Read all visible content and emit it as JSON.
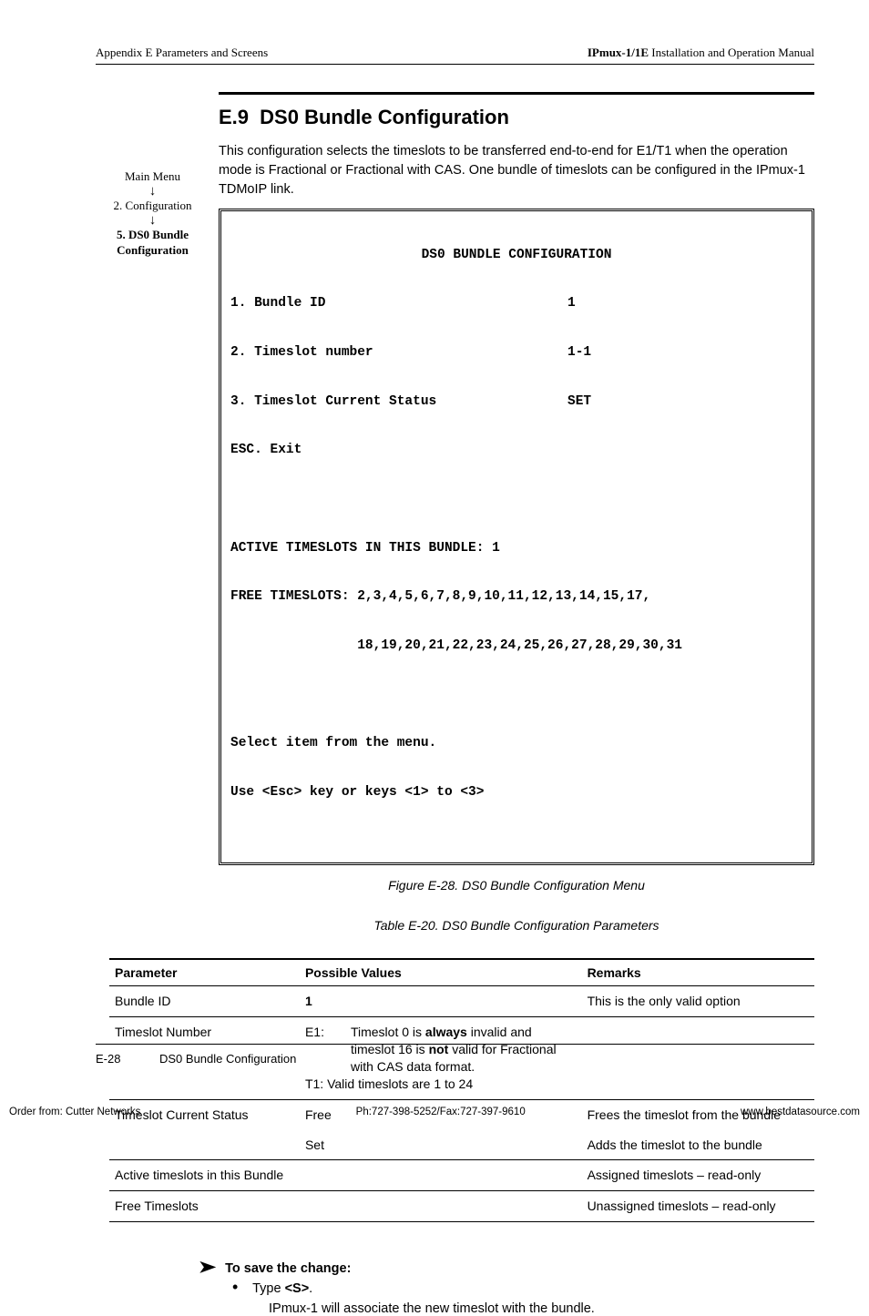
{
  "header": {
    "left": "Appendix E  Parameters and Screens",
    "right_bold": "IPmux-1/1E",
    "right_rest": " Installation and Operation Manual"
  },
  "sidebar": {
    "l1": "Main Menu",
    "arrow": "↓",
    "l2": "2. Configuration",
    "l3a": "5. DS0 Bundle",
    "l3b": "Configuration"
  },
  "section": {
    "number": "E.9",
    "title": "DS0 Bundle Configuration",
    "intro": "This configuration selects the timeslots to be transferred end-to-end for E1/T1 when the operation mode is Fractional or Fractional with CAS. One bundle of timeslots can be configured in the IPmux-1 TDMoIP link."
  },
  "terminal": {
    "title": "DS0 BUNDLE CONFIGURATION",
    "rows": [
      {
        "k": "1. Bundle ID",
        "v": "1"
      },
      {
        "k": "2. Timeslot number",
        "v": "1-1"
      },
      {
        "k": "3. Timeslot Current Status",
        "v": "SET"
      }
    ],
    "esc": "ESC. Exit",
    "active": "ACTIVE TIMESLOTS IN THIS BUNDLE: 1",
    "free1": "FREE TIMESLOTS: 2,3,4,5,6,7,8,9,10,11,12,13,14,15,17,",
    "free2": "                18,19,20,21,22,23,24,25,26,27,28,29,30,31",
    "sel": "Select item from the menu.",
    "use": "Use <Esc> key or keys <1> to <3>"
  },
  "figure_caption": "Figure E-28.  DS0 Bundle Configuration Menu",
  "table_caption": "Table E-20.  DS0 Bundle Configuration Parameters",
  "table": {
    "head": [
      "Parameter",
      "Possible Values",
      "Remarks"
    ],
    "r1": {
      "p": "Bundle ID",
      "v": "1",
      "r": "This is the only valid option"
    },
    "r2": {
      "p": "Timeslot Number",
      "e1_label": "E1:",
      "e1_a": "Timeslot 0 is ",
      "e1_b": "always",
      "e1_c": " invalid and timeslot 16 is ",
      "e1_d": "not",
      "e1_e": " valid for Fractional with CAS data format.",
      "t1": "T1: Valid timeslots are 1 to 24"
    },
    "r3a": {
      "p": "Timeslot Current Status",
      "v": "Free",
      "r": "Frees the timeslot from the bundle"
    },
    "r3b": {
      "v": "Set",
      "r": "Adds the timeslot to the bundle"
    },
    "r4": {
      "p": "Active timeslots in this Bundle",
      "r": "Assigned timeslots – read-only"
    },
    "r5": {
      "p": "Free Timeslots",
      "r": "Unassigned timeslots – read-only"
    }
  },
  "save": {
    "head": "To save the change:",
    "type_a": "Type ",
    "type_b": "<S>",
    "type_c": ".",
    "assoc": "IPmux-1 will associate the new timeslot with the bundle."
  },
  "footer": {
    "page": "E-28",
    "title": "DS0 Bundle Configuration"
  },
  "order": {
    "left": "Order from: Cutter Networks",
    "mid": "Ph:727-398-5252/Fax:727-397-9610",
    "right": "www.bestdatasource.com"
  }
}
